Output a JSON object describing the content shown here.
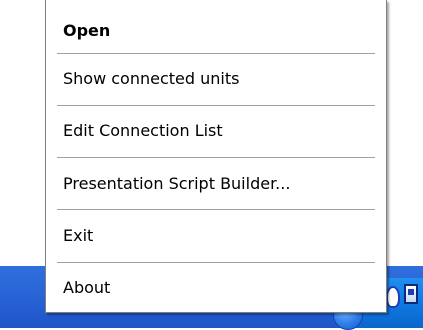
{
  "context_menu": {
    "items": [
      {
        "label": "Open",
        "bold": true
      },
      {
        "label": "Show connected  units",
        "bold": false
      },
      {
        "label": "Edit Connection List",
        "bold": false
      },
      {
        "label": "Presentation Script Builder...",
        "bold": false
      },
      {
        "label": "Exit",
        "bold": false
      },
      {
        "label": "About",
        "bold": false
      }
    ]
  },
  "taskbar": {
    "tray_icons": [
      "tray-round-icon",
      "tray-red-app-icon",
      "tray-blue-app-icon",
      "tray-network-icon"
    ]
  }
}
